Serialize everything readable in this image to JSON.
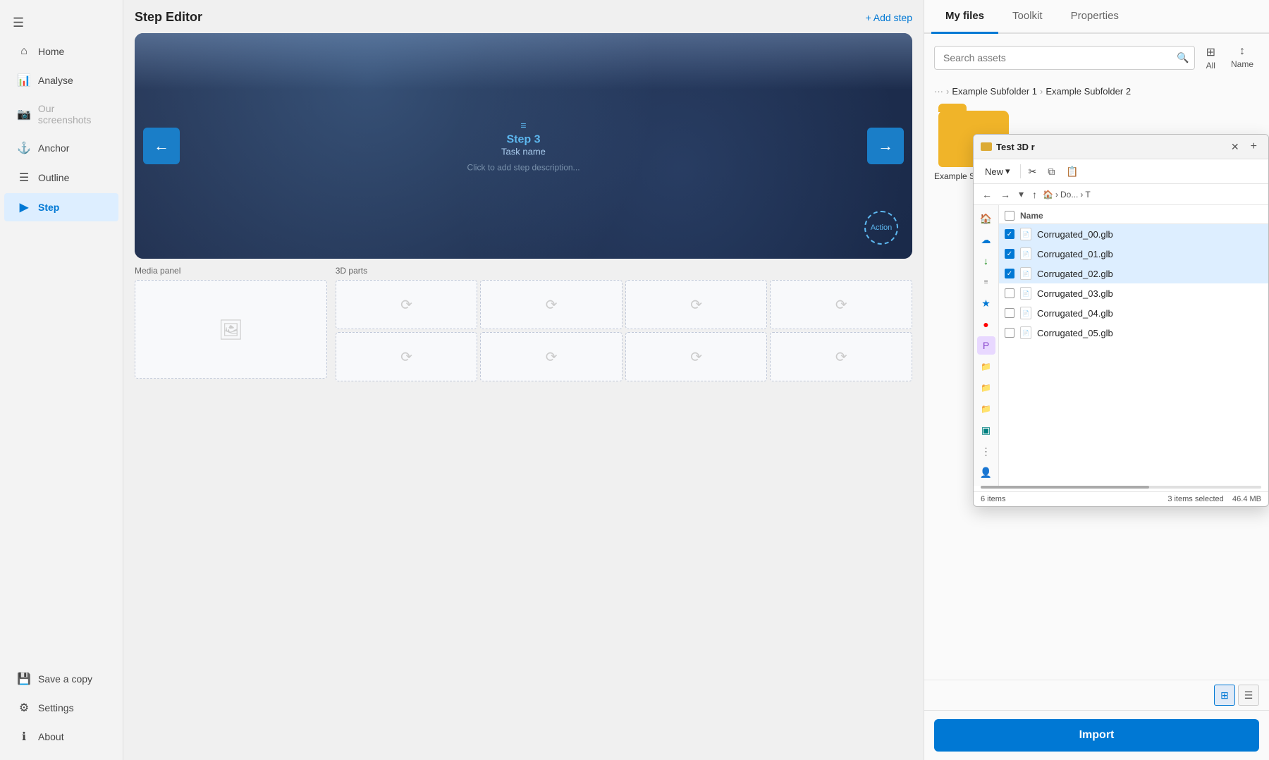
{
  "sidebar": {
    "menu_icon": "☰",
    "items": [
      {
        "id": "home",
        "label": "Home",
        "icon": "⌂",
        "active": false,
        "disabled": false
      },
      {
        "id": "analyse",
        "label": "Analyse",
        "icon": "📊",
        "active": false,
        "disabled": false
      },
      {
        "id": "our-screenshots",
        "label": "Our screenshots",
        "icon": "📷",
        "active": false,
        "disabled": true
      },
      {
        "id": "anchor",
        "label": "Anchor",
        "icon": "⚓",
        "active": false,
        "disabled": false
      },
      {
        "id": "outline",
        "label": "Outline",
        "icon": "☰",
        "active": false,
        "disabled": false
      },
      {
        "id": "step",
        "label": "Step",
        "icon": "▶",
        "active": true,
        "disabled": false
      }
    ],
    "bottom_items": [
      {
        "id": "save-copy",
        "label": "Save a copy",
        "icon": "💾",
        "active": false,
        "disabled": false
      },
      {
        "id": "settings",
        "label": "Settings",
        "icon": "⚙",
        "active": false,
        "disabled": false
      },
      {
        "id": "about",
        "label": "About",
        "icon": "ℹ",
        "active": false,
        "disabled": false
      }
    ]
  },
  "step_editor": {
    "title": "Step Editor",
    "add_step_label": "+ Add step",
    "step": {
      "name": "Step 3",
      "task_name": "Task name",
      "description": "Click to add step description...",
      "action_label": "Action"
    }
  },
  "media_panel": {
    "label": "Media panel",
    "cells": 1
  },
  "parts_panel": {
    "label": "3D parts",
    "cells": 8
  },
  "right_panel": {
    "tabs": [
      {
        "id": "my-files",
        "label": "My files",
        "active": true
      },
      {
        "id": "toolkit",
        "label": "Toolkit",
        "active": false
      },
      {
        "id": "properties",
        "label": "Properties",
        "active": false
      }
    ],
    "search": {
      "placeholder": "Search assets"
    },
    "filter": {
      "all_label": "All",
      "name_label": "Name"
    },
    "breadcrumb": {
      "dots": "···",
      "items": [
        "Example Subfolder 1",
        "Example Subfolder 2"
      ]
    },
    "folder": {
      "name": "Example Subfolder 3"
    },
    "import_label": "Import",
    "view_toggle": {
      "grid_label": "⊞",
      "list_label": "≡"
    }
  },
  "file_explorer": {
    "title": "Test 3D r",
    "folder_icon": "📁",
    "toolbar": {
      "new_label": "New",
      "cut_icon": "✂",
      "copy_icon": "⧉",
      "paste_icon": "📋"
    },
    "nav": {
      "back_label": "←",
      "forward_label": "→",
      "up_label": "↑",
      "path_parts": [
        "Do...",
        "T"
      ]
    },
    "header": {
      "name_col": "Name"
    },
    "files": [
      {
        "name": "Corrugated_00.glb",
        "checked": true
      },
      {
        "name": "Corrugated_01.glb",
        "checked": true
      },
      {
        "name": "Corrugated_02.glb",
        "checked": true
      },
      {
        "name": "Corrugated_03.glb",
        "checked": false
      },
      {
        "name": "Corrugated_04.glb",
        "checked": false
      },
      {
        "name": "Corrugated_05.glb",
        "checked": false
      }
    ],
    "status": {
      "total": "6 items",
      "selected": "3 items selected",
      "size": "46.4 MB"
    }
  }
}
